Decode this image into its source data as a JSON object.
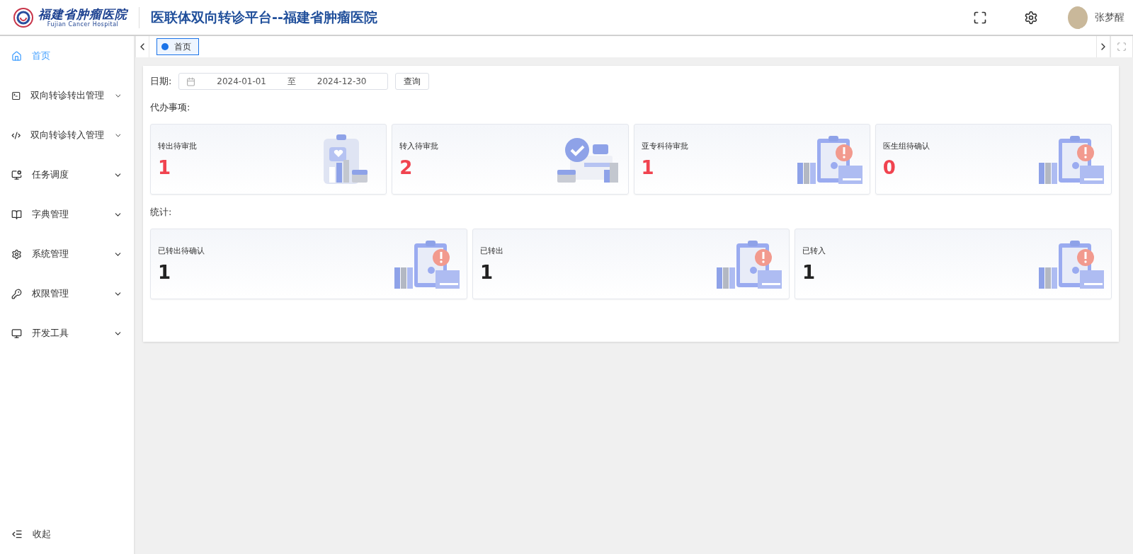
{
  "header": {
    "logo_name": "福建省肿瘤医院",
    "logo_subtitle": "Fujian Cancer Hospital",
    "title": "医联体双向转诊平台--福建省肿瘤医院",
    "user": "张梦醒"
  },
  "sidebar": {
    "items": [
      {
        "label": "首页",
        "selected": true,
        "expandable": false
      },
      {
        "label": "双向转诊转出管理",
        "selected": false,
        "expandable": true
      },
      {
        "label": "双向转诊转入管理",
        "selected": false,
        "expandable": true
      },
      {
        "label": "任务调度",
        "selected": false,
        "expandable": true
      },
      {
        "label": "字典管理",
        "selected": false,
        "expandable": true
      },
      {
        "label": "系统管理",
        "selected": false,
        "expandable": true
      },
      {
        "label": "权限管理",
        "selected": false,
        "expandable": true
      },
      {
        "label": "开发工具",
        "selected": false,
        "expandable": true
      }
    ],
    "collapse": "收起"
  },
  "tabs": [
    {
      "label": "首页",
      "selected": true
    }
  ],
  "filter": {
    "label": "日期:",
    "start": "2024-01-01",
    "separator": "至",
    "end": "2024-12-30",
    "button": "查询"
  },
  "sections": [
    {
      "title": "代办事项:",
      "highlight": true,
      "cards": [
        {
          "label": "转出待审批",
          "value": "1",
          "kind": "chart"
        },
        {
          "label": "转入待审批",
          "value": "2",
          "kind": "check"
        },
        {
          "label": "亚专科待审批",
          "value": "1",
          "kind": "alert"
        },
        {
          "label": "医生组待确认",
          "value": "0",
          "kind": "alert"
        }
      ]
    },
    {
      "title": "统计:",
      "highlight": false,
      "cards": [
        {
          "label": "已转出待确认",
          "value": "1",
          "kind": "alert"
        },
        {
          "label": "已转出",
          "value": "1",
          "kind": "alert"
        },
        {
          "label": "已转入",
          "value": "1",
          "kind": "alert"
        }
      ]
    }
  ]
}
